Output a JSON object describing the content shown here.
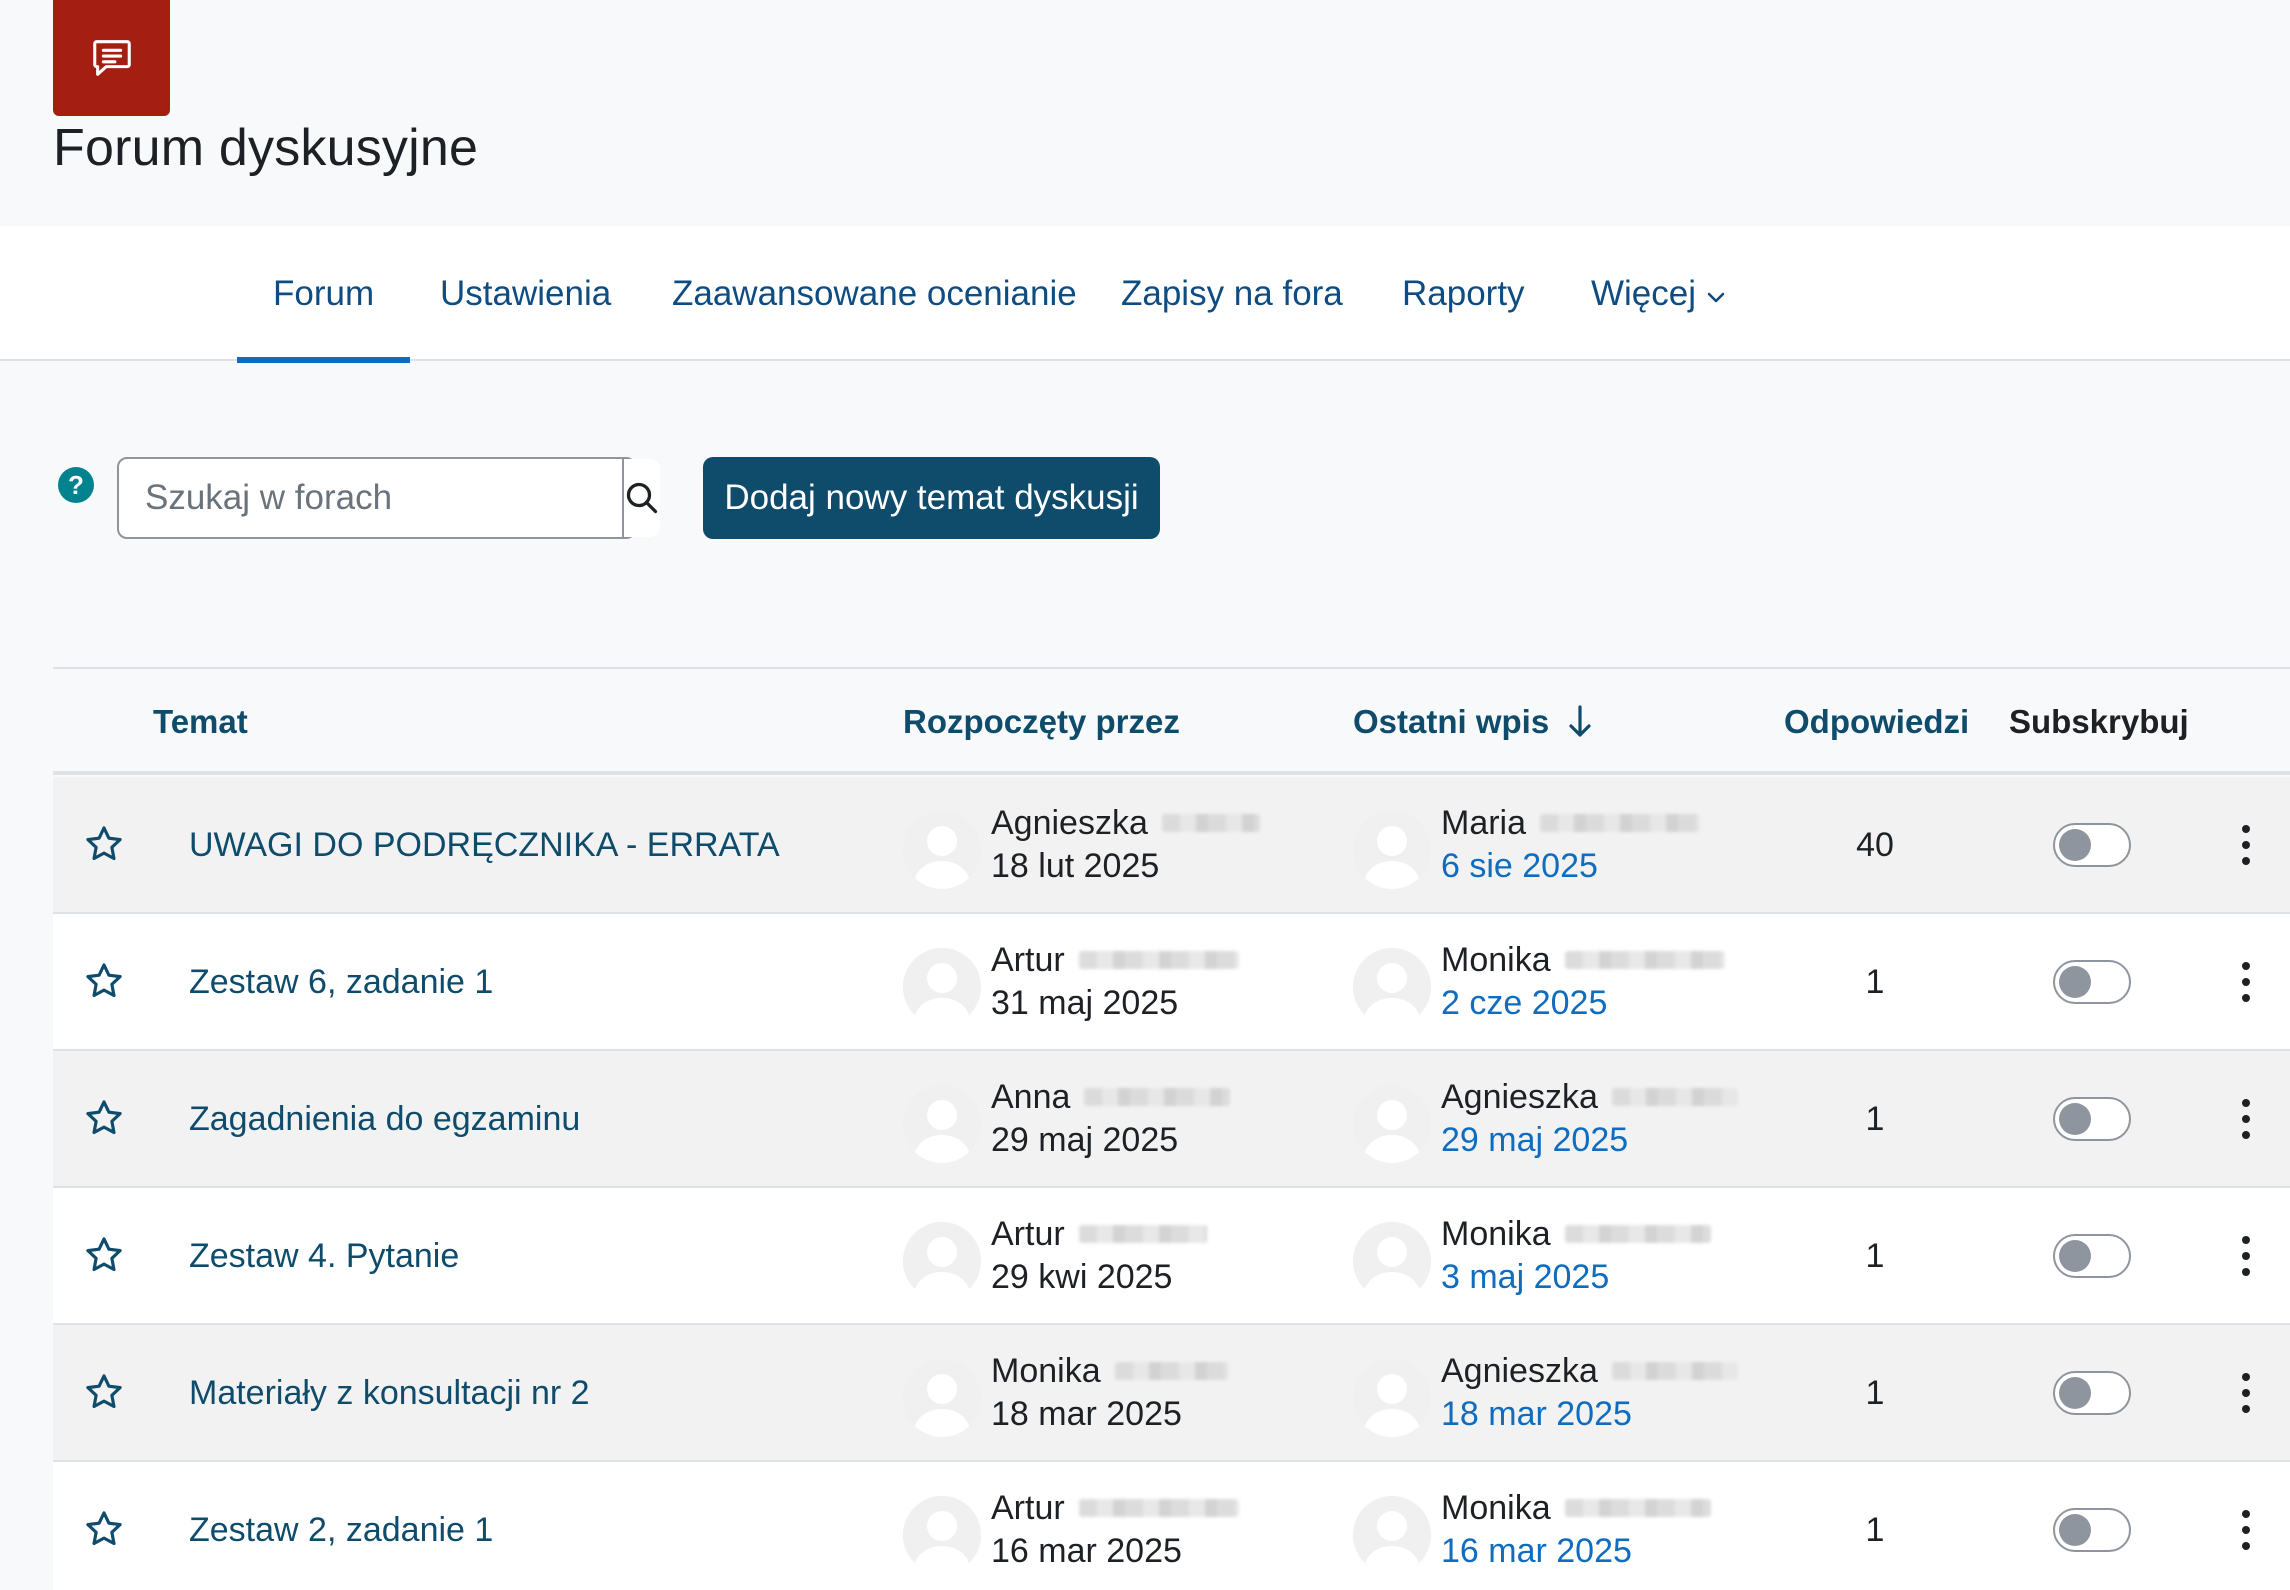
{
  "header": {
    "title": "Forum dyskusyjne",
    "icon": "forum-chat-icon",
    "accent_color": "#a51e12"
  },
  "nav": {
    "tabs": [
      {
        "label": "Forum",
        "active": true
      },
      {
        "label": "Ustawienia",
        "active": false
      },
      {
        "label": "Zaawansowane ocenianie",
        "active": false
      },
      {
        "label": "Zapisy na fora",
        "active": false
      },
      {
        "label": "Raporty",
        "active": false
      },
      {
        "label": "Więcej",
        "active": false
      }
    ]
  },
  "toolbar": {
    "help_label": "?",
    "search_placeholder": "Szukaj w forach",
    "add_button_label": "Dodaj nowy temat dyskusji"
  },
  "table": {
    "columns": {
      "topic": "Temat",
      "started_by": "Rozpoczęty przez",
      "last_post": "Ostatni wpis",
      "replies": "Odpowiedzi",
      "subscribe": "Subskrybuj"
    },
    "sort_indicator": "arrow-down-icon",
    "rows": [
      {
        "topic": "UWAGI DO PODRĘCZNIKA - ERRATA",
        "starter": "Agnieszka",
        "start_date": "18 lut 2025",
        "last_author": "Maria",
        "last_date": "6 sie 2025",
        "replies": "40",
        "subscribed": false
      },
      {
        "topic": "Zestaw 6, zadanie 1",
        "starter": "Artur",
        "start_date": "31 maj 2025",
        "last_author": "Monika",
        "last_date": "2 cze 2025",
        "replies": "1",
        "subscribed": false
      },
      {
        "topic": "Zagadnienia do egzaminu",
        "starter": "Anna",
        "start_date": "29 maj 2025",
        "last_author": "Agnieszka",
        "last_date": "29 maj 2025",
        "replies": "1",
        "subscribed": false
      },
      {
        "topic": "Zestaw 4. Pytanie",
        "starter": "Artur",
        "start_date": "29 kwi 2025",
        "last_author": "Monika",
        "last_date": "3 maj 2025",
        "replies": "1",
        "subscribed": false
      },
      {
        "topic": "Materiały z konsultacji nr 2",
        "starter": "Monika",
        "start_date": "18 mar 2025",
        "last_author": "Agnieszka",
        "last_date": "18 mar 2025",
        "replies": "1",
        "subscribed": false
      },
      {
        "topic": "Zestaw 2, zadanie 1",
        "starter": "Artur",
        "start_date": "16 mar 2025",
        "last_author": "Monika",
        "last_date": "16 mar 2025",
        "replies": "1",
        "subscribed": false
      }
    ]
  }
}
